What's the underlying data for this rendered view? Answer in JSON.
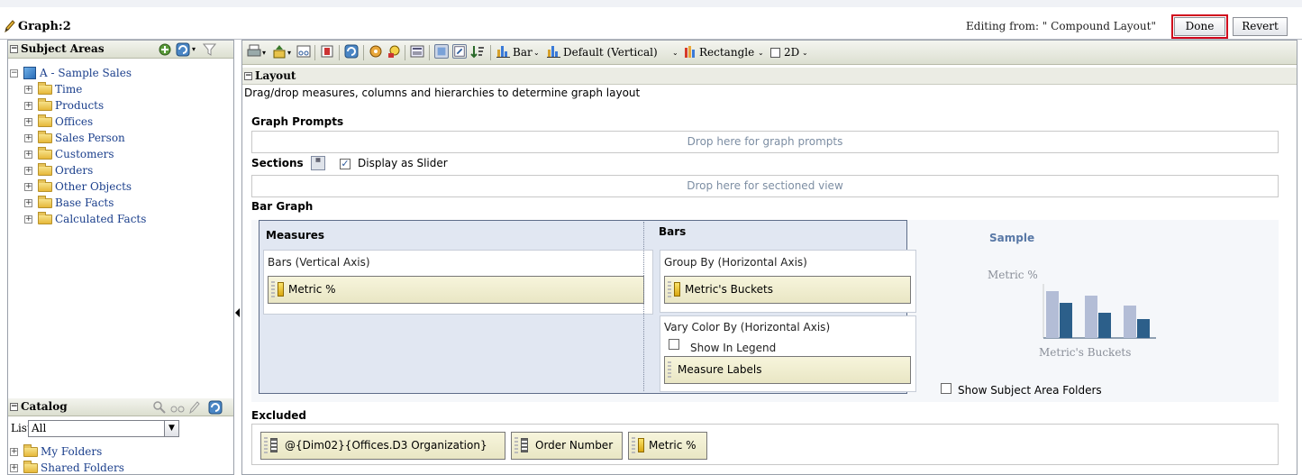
{
  "window": {
    "title": "Graph:2",
    "editing_from": "Editing from: \" Compound Layout\"",
    "done_label": "Done",
    "revert_label": "Revert"
  },
  "subject_areas": {
    "title": "Subject Areas",
    "root": "A - Sample Sales",
    "folders": [
      "Time",
      "Products",
      "Offices",
      "Sales Person",
      "Customers",
      "Orders",
      "Other Objects",
      "Base Facts",
      "Calculated Facts"
    ]
  },
  "catalog": {
    "title": "Catalog",
    "list_label": "List",
    "list_value": "All",
    "folders": [
      "My Folders",
      "Shared Folders"
    ]
  },
  "toolbar": {
    "graph_type": "Bar",
    "graph_subtype": "Default (Vertical)",
    "style": "Rectangle",
    "dimension": "2D"
  },
  "layout": {
    "title": "Layout",
    "description": "Drag/drop measures, columns and hierarchies to determine graph layout",
    "graph_prompts_label": "Graph Prompts",
    "graph_prompts_drop": "Drop here for graph prompts",
    "sections_label": "Sections",
    "display_as_slider": "Display as Slider",
    "sections_drop": "Drop here for sectioned view",
    "bar_graph_label": "Bar Graph",
    "measures_head": "Measures",
    "bars_axis_label": "Bars (Vertical Axis)",
    "bars_axis_item": "Metric %",
    "bars_head": "Bars",
    "group_by_label": "Group By (Horizontal Axis)",
    "group_by_item": "Metric's Buckets",
    "vary_color_label": "Vary Color By (Horizontal Axis)",
    "show_in_legend": "Show In Legend",
    "vary_color_item": "Measure Labels",
    "sample_title": "Sample",
    "sample_y_label": "Metric %",
    "sample_x_label": "Metric's Buckets",
    "show_subject_area_folders": "Show Subject Area Folders",
    "excluded_label": "Excluded",
    "excluded_items": [
      "@{Dim02}{Offices.D3 Organization}",
      "Order Number",
      "Metric %"
    ]
  },
  "colors": {
    "sample_bar_light": "#b3bdd6",
    "sample_bar_dark": "#2c5f8a",
    "done_outline": "#d0021b"
  }
}
